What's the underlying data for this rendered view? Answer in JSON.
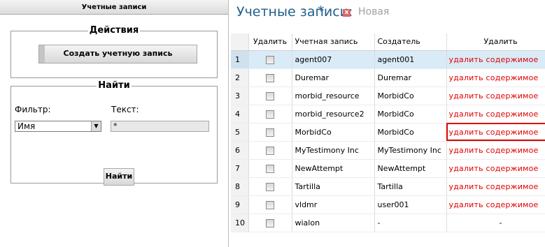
{
  "left_panel": {
    "header": "Учетные записи",
    "actions": {
      "legend": "Действия",
      "create_button": "Создать учетную запись"
    },
    "find": {
      "legend": "Найти",
      "filter_label": "Фильтр:",
      "text_label": "Текст:",
      "filter_value": "Имя",
      "text_value": "*",
      "find_button": "Найти"
    }
  },
  "right_panel": {
    "tab_title": "Учетные записи:",
    "tab_star": "*",
    "tab_close": "x",
    "tab_new": "Новая",
    "columns": [
      "",
      "Удалить",
      "Учетная запись",
      "Создатель",
      "Удалить"
    ],
    "rows": [
      {
        "n": "1",
        "account": "agent007",
        "creator": "agent001",
        "delete": "удалить содержимое",
        "selected": true
      },
      {
        "n": "2",
        "account": "Duremar",
        "creator": "Duremar",
        "delete": "удалить содержимое"
      },
      {
        "n": "3",
        "account": "morbid_resource",
        "creator": "MorbidCo",
        "delete": "удалить содержимое"
      },
      {
        "n": "4",
        "account": "morbid_resource2",
        "creator": "MorbidCo",
        "delete": "удалить содержимое"
      },
      {
        "n": "5",
        "account": "MorbidCo",
        "creator": "MorbidCo",
        "delete": "удалить содержимое",
        "highlighted": true
      },
      {
        "n": "6",
        "account": "MyTestimony Inc",
        "creator": "MyTestimony Inc",
        "delete": "удалить содержимое"
      },
      {
        "n": "7",
        "account": "NewAttempt",
        "creator": "NewAttempt",
        "delete": "удалить содержимое"
      },
      {
        "n": "8",
        "account": "Tartilla",
        "creator": "Tartilla",
        "delete": "удалить содержимое"
      },
      {
        "n": "9",
        "account": "vldmr",
        "creator": "user001",
        "delete": "удалить содержимое"
      },
      {
        "n": "10",
        "account": "wialon",
        "creator": "-",
        "delete": "-"
      }
    ]
  },
  "colors": {
    "title_blue": "#1f5f8c",
    "delete_red": "#e00000",
    "selected_row": "#d9ebf7"
  }
}
